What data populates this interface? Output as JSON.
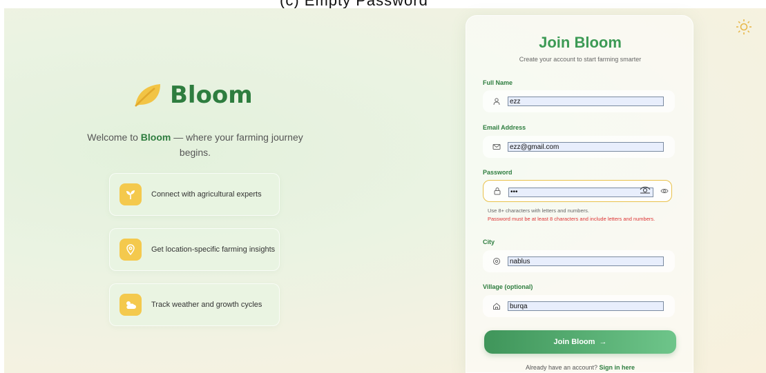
{
  "top_caption": "(c) Empty Password",
  "theme_toggle": {
    "icon": "sun-icon"
  },
  "brand": {
    "name": "Bloom",
    "logo_icon": "leaf-icon"
  },
  "welcome": {
    "prefix": "Welcome to ",
    "brand": "Bloom",
    "suffix": " — where your farming journey begins."
  },
  "features": [
    {
      "icon": "sprout-icon",
      "label": "Connect with agricultural experts"
    },
    {
      "icon": "location-pin-icon",
      "label": "Get location-specific farming insights"
    },
    {
      "icon": "weather-icon",
      "label": "Track weather and growth cycles"
    }
  ],
  "form": {
    "title": "Join Bloom",
    "subtitle": "Create your account to start farming smarter",
    "full_name": {
      "label": "Full Name",
      "value": "ezz"
    },
    "email": {
      "label": "Email Address",
      "value": "ezz@gmail.com"
    },
    "password": {
      "label": "Password",
      "value": "•••",
      "hint": "Use 8+ characters with letters and numbers.",
      "error": "Password must be at least 8 characters and include letters and numbers."
    },
    "city": {
      "label": "City",
      "value": "nablus"
    },
    "village": {
      "label": "Village (optional)",
      "value": "burqa"
    },
    "submit_label": "Join Bloom",
    "signin_prompt": "Already have an account?",
    "signin_link": "Sign in here"
  },
  "colors": {
    "brand_green": "#2e7d3f",
    "accent_yellow": "#f4c94d",
    "error_red": "#dd3333"
  }
}
